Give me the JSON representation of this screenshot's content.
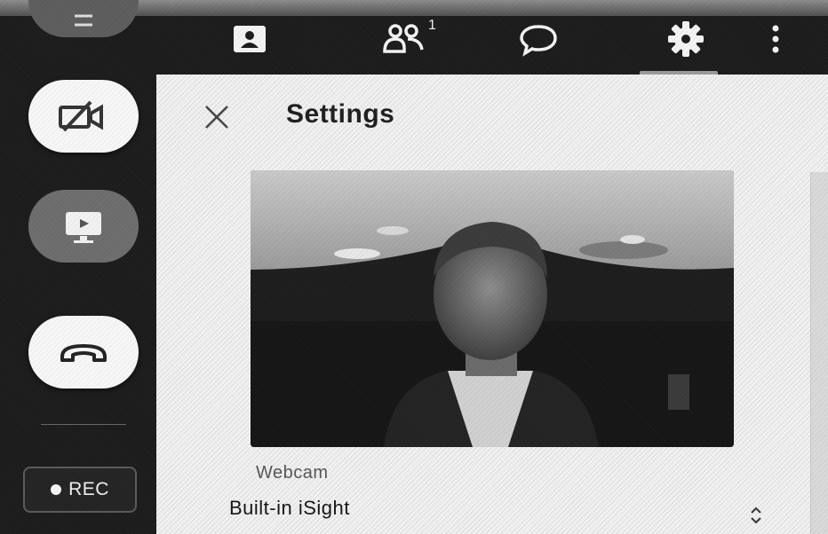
{
  "toolbar": {
    "participants_count": "1",
    "icons": [
      "contact-card-icon",
      "participants-icon",
      "chat-icon",
      "settings-gear-icon",
      "more-vertical-icon"
    ]
  },
  "rail": {
    "icons": [
      "menu-icon",
      "camera-off-icon",
      "screen-share-icon",
      "hang-up-icon"
    ],
    "rec_label": "REC"
  },
  "settings": {
    "title": "Settings",
    "webcam_label": "Webcam",
    "webcam_value": "Built-in iSight"
  }
}
